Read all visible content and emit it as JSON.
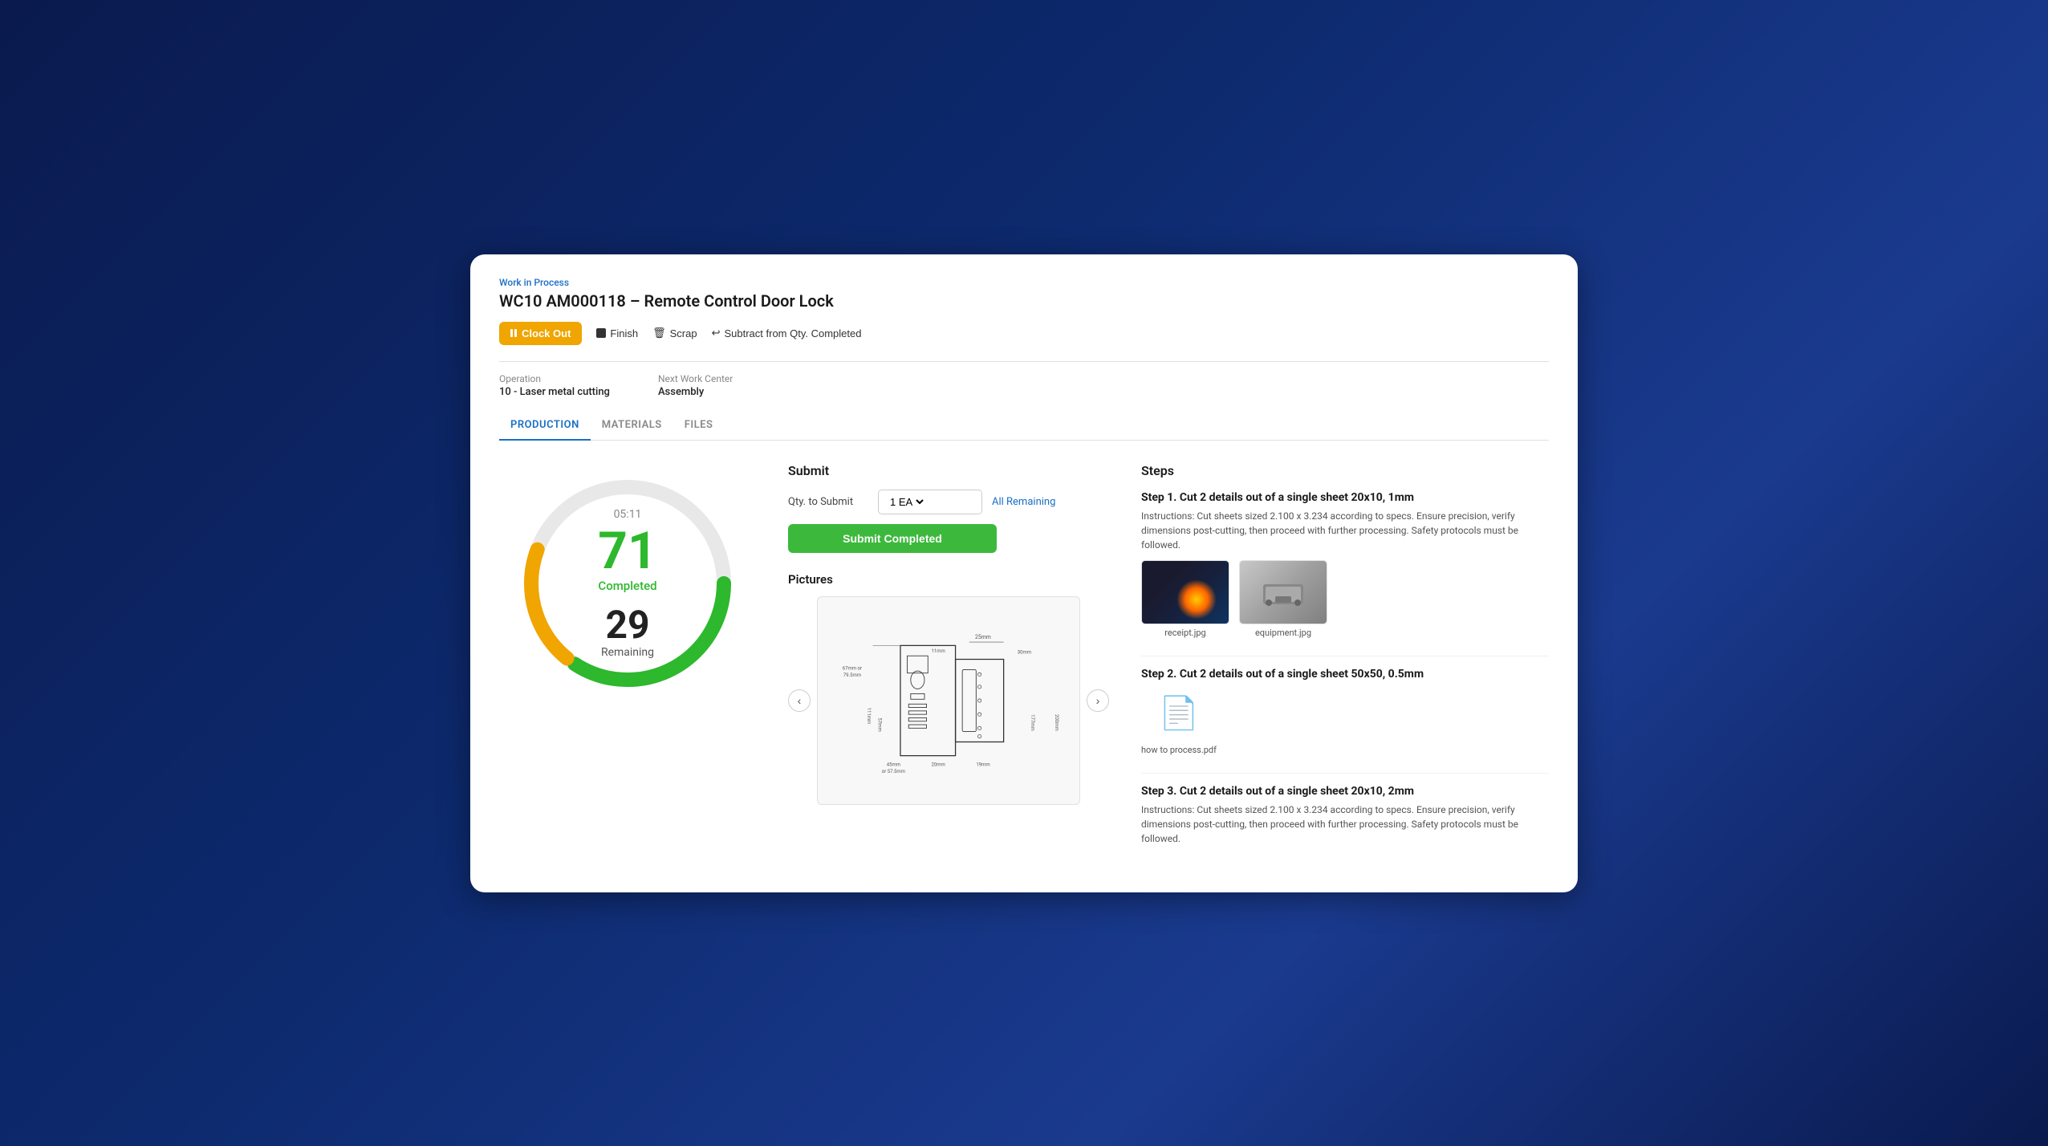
{
  "breadcrumb": "Work in Process",
  "title": "WC10 AM000118 – Remote Control Door Lock",
  "toolbar": {
    "clock_out": "Clock Out",
    "finish": "Finish",
    "scrap": "Scrap",
    "subtract": "Subtract from Qty. Completed"
  },
  "info": {
    "operation_label": "Operation",
    "operation_value": "10 - Laser metal cutting",
    "next_work_center_label": "Next Work Center",
    "next_work_center_value": "Assembly"
  },
  "tabs": [
    {
      "id": "production",
      "label": "PRODUCTION",
      "active": true
    },
    {
      "id": "materials",
      "label": "MATERIALS",
      "active": false
    },
    {
      "id": "files",
      "label": "FILES",
      "active": false
    }
  ],
  "gauge": {
    "time": "05:11",
    "completed_num": "71",
    "completed_label": "Completed",
    "remaining_num": "29",
    "remaining_label": "Remaining",
    "completed_pct": 71,
    "remaining_pct": 29
  },
  "submit": {
    "title": "Submit",
    "qty_label": "Qty. to Submit",
    "qty_value": "1 EA",
    "all_remaining": "All Remaining",
    "submit_btn": "Submit Completed"
  },
  "pictures": {
    "title": "Pictures"
  },
  "steps": {
    "title": "Steps",
    "items": [
      {
        "heading": "Step 1. Cut 2 details out of a single sheet 20x10, 1mm",
        "desc": "Instructions: Cut sheets sized 2.100 x 3.234 according to specs. Ensure precision, verify dimensions post-cutting, then proceed with further processing. Safety protocols must be followed.",
        "images": [
          {
            "label": "receipt.jpg",
            "type": "laser"
          },
          {
            "label": "equipment.jpg",
            "type": "equipment"
          }
        ]
      },
      {
        "heading": "Step 2. Cut 2 details out of a single sheet 50x50, 0.5mm",
        "desc": "",
        "images": [
          {
            "label": "how to process.pdf",
            "type": "pdf"
          }
        ]
      },
      {
        "heading": "Step 3. Cut 2 details out of a single sheet 20x10, 2mm",
        "desc": "Instructions: Cut sheets sized 2.100 x 3.234 according to specs. Ensure precision, verify dimensions post-cutting, then proceed with further processing. Safety protocols must be followed.",
        "images": []
      }
    ]
  }
}
